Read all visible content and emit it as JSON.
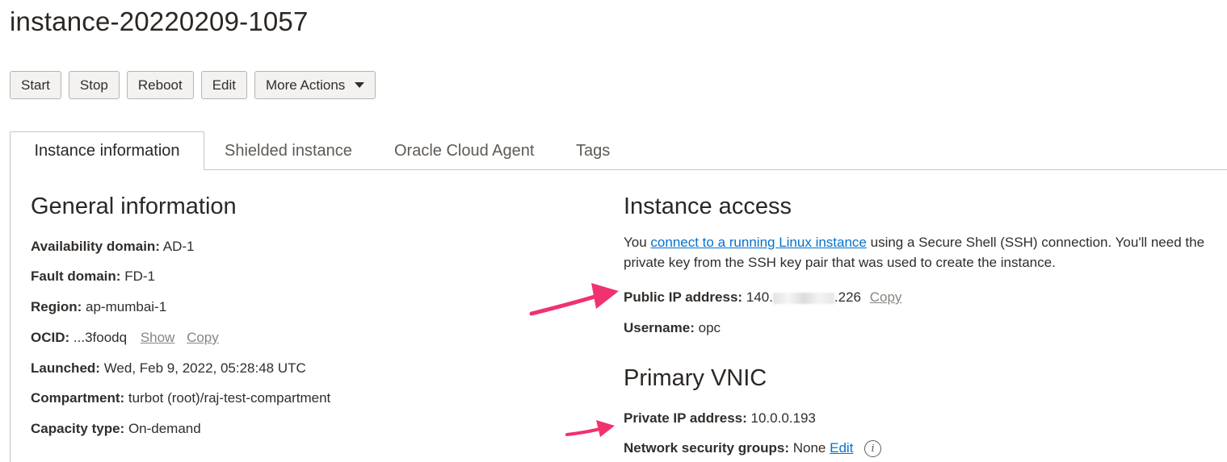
{
  "page": {
    "title": "instance-20220209-1057"
  },
  "toolbar": {
    "start": "Start",
    "stop": "Stop",
    "reboot": "Reboot",
    "edit": "Edit",
    "more_actions": "More Actions"
  },
  "tabs": {
    "instance_information": "Instance information",
    "shielded_instance": "Shielded instance",
    "oracle_cloud_agent": "Oracle Cloud Agent",
    "tags": "Tags"
  },
  "general": {
    "heading": "General information",
    "availability_domain": {
      "label": "Availability domain:",
      "value": "AD-1"
    },
    "fault_domain": {
      "label": "Fault domain:",
      "value": "FD-1"
    },
    "region": {
      "label": "Region:",
      "value": "ap-mumbai-1"
    },
    "ocid": {
      "label": "OCID:",
      "value": "...3foodq",
      "show": "Show",
      "copy": "Copy"
    },
    "launched": {
      "label": "Launched:",
      "value": "Wed, Feb 9, 2022, 05:28:48 UTC"
    },
    "compartment": {
      "label": "Compartment:",
      "value": "turbot (root)/raj-test-compartment"
    },
    "capacity_type": {
      "label": "Capacity type:",
      "value": "On-demand"
    }
  },
  "access": {
    "heading": "Instance access",
    "desc_prefix": "You ",
    "desc_link": "connect to a running Linux instance",
    "desc_suffix": " using a Secure Shell (SSH) connection. You'll need the private key from the SSH key pair that was used to create the instance.",
    "public_ip": {
      "label": "Public IP address:",
      "value_start": "140.",
      "value_end": ".226",
      "copy": "Copy"
    },
    "username": {
      "label": "Username:",
      "value": "opc"
    }
  },
  "vnic": {
    "heading": "Primary VNIC",
    "private_ip": {
      "label": "Private IP address:",
      "value": "10.0.0.193"
    },
    "nsg": {
      "label": "Network security groups:",
      "value": "None",
      "edit": "Edit"
    }
  },
  "icons": {
    "dropdown": "chevron-down-icon",
    "info": "info-icon",
    "annotation": "arrow-icon"
  },
  "colors": {
    "link": "#0572ce",
    "annotation_arrow": "#f0326e"
  }
}
